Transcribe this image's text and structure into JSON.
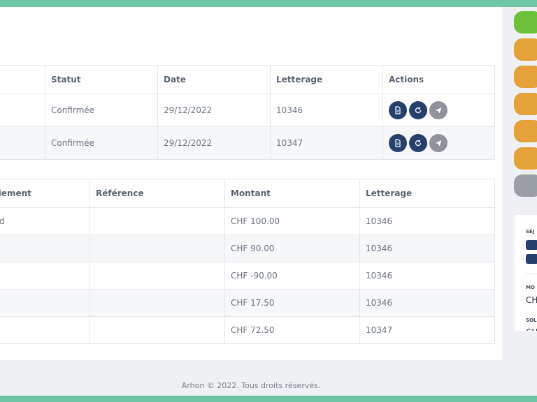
{
  "orders_table": {
    "headers": [
      "Statut",
      "Date",
      "Letterage",
      "Actions"
    ],
    "rows": [
      {
        "statut": "Confirmée",
        "date": "29/12/2022",
        "letterage": "10346"
      },
      {
        "statut": "Confirmée",
        "date": "29/12/2022",
        "letterage": "10347"
      }
    ]
  },
  "payments_table": {
    "headers": [
      "paiement",
      "Référence",
      "Montant",
      "Letterage"
    ],
    "rows": [
      {
        "paiement": "d",
        "reference": "",
        "montant": "CHF 100.00",
        "letterage": "10346"
      },
      {
        "paiement": "",
        "reference": "",
        "montant": "CHF 90.00",
        "letterage": "10346"
      },
      {
        "paiement": "",
        "reference": "",
        "montant": "CHF -90.00",
        "letterage": "10346"
      },
      {
        "paiement": "",
        "reference": "",
        "montant": "CHF 17.50",
        "letterage": "10346"
      },
      {
        "paiement": "",
        "reference": "",
        "montant": "CHF 72.50",
        "letterage": "10347"
      }
    ]
  },
  "side_panel": {
    "sejour_label": "SÉJ",
    "montant_label": "MO",
    "montant_value": "CH",
    "solde_label": "SOL",
    "solde_value": "CH"
  },
  "footer": {
    "text": "Arhon © 2022. Tous droits réservés."
  },
  "colors": {
    "accent": "#6fc6a4",
    "action_dark": "#26406b",
    "action_grey": "#8e939b",
    "pill_green": "#6cc03a",
    "pill_orange": "#e3a23a",
    "pill_grey": "#9a9ea5"
  },
  "icons": {
    "action_1": "document-icon",
    "action_2": "refresh-icon",
    "action_3": "send-icon"
  }
}
